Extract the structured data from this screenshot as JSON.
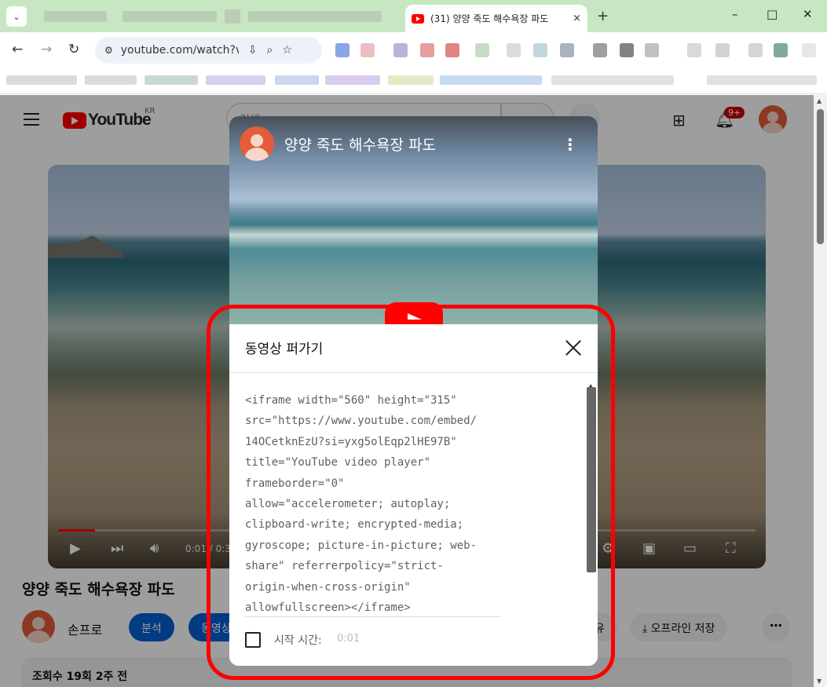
{
  "browser": {
    "active_tab_title": "(31) 양양 죽도 해수욕장 파도",
    "tab_close": "×",
    "new_tab": "+",
    "address": "youtube.com/watch?v...",
    "window_controls": {
      "minimize": "–",
      "maximize": "□",
      "close": "✕"
    }
  },
  "youtube": {
    "logo_text": "YouTube",
    "region": "KR",
    "search_placeholder": "검색",
    "notification_count": "9+"
  },
  "player": {
    "progress_fraction": 0.053,
    "time": "0:01 / 0:3"
  },
  "video": {
    "title": "양양 죽도 해수욕장 파도",
    "channel": "손프로",
    "analytics_button": "분석",
    "edit_button": "동영상",
    "share_button": "공유",
    "download_button": "오프라인 저장",
    "more_button": "⋯",
    "stats": "조회수 19회  2주 전"
  },
  "embed_dialog": {
    "preview_title": "양양 죽도 해수욕장 파도",
    "title": "동영상 퍼가기",
    "code": "<iframe width=\"560\" height=\"315\"\nsrc=\"https://www.youtube.com/embed/\n14OCetknEzU?si=yxg5olEqp2lHE97B\"\ntitle=\"YouTube video player\"\nframeborder=\"0\"\nallow=\"accelerometer; autoplay;\nclipboard-write; encrypted-media;\ngyroscope; picture-in-picture; web-\nshare\" referrerpolicy=\"strict-\norigin-when-cross-origin\"\nallowfullscreen></iframe>",
    "start_time_label": "시작 시간:",
    "start_time_value": "0:01",
    "start_time_checked": false
  },
  "colors": {
    "youtube_red": "#ff0000",
    "subscribe_blue": "#065fd4",
    "highlight": "#ff0000"
  }
}
